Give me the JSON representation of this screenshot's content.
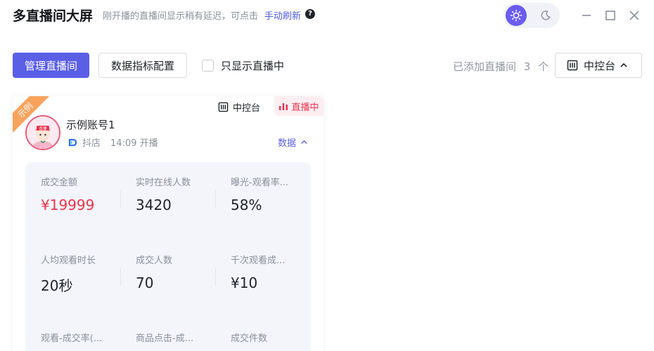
{
  "header": {
    "title": "多直播间大屏",
    "subtitle": "刚开播的直播间显示稍有延迟，可点击",
    "refresh_link": "手动刷新",
    "help_glyph": "?"
  },
  "theme": {
    "active": "light",
    "icons": [
      "sun-icon",
      "moon-icon"
    ],
    "accent": "#6b5cf0"
  },
  "window_controls": [
    "minimize-icon",
    "maximize-icon",
    "close-icon"
  ],
  "toolbar": {
    "manage_label": "管理直播间",
    "metrics_config_label": "数据指标配置",
    "only_live_label": "只显示直播中",
    "only_live_checked": false,
    "added_label": "已添加直播间",
    "added_count": "3",
    "added_unit": "个",
    "console_label": "中控台"
  },
  "card": {
    "ribbon_text": "示例",
    "console_label": "中控台",
    "live_label": "直播中",
    "account_name": "示例账号1",
    "avatar_text": "直播",
    "platform": "抖店",
    "start_time": "14:09 开播",
    "data_toggle_label": "数据",
    "metrics": [
      {
        "label": "成交金额",
        "value": "¥19999"
      },
      {
        "label": "实时在线人数",
        "value": "3420"
      },
      {
        "label": "曝光-观看率...",
        "value": "58%"
      },
      {
        "label": "人均观看时长",
        "value": "20秒"
      },
      {
        "label": "成交人数",
        "value": "70"
      },
      {
        "label": "千次观看成...",
        "value": "¥10"
      },
      {
        "label": "观看-成交率(...",
        "value": ""
      },
      {
        "label": "商品点击-成...",
        "value": ""
      },
      {
        "label": "成交件数",
        "value": ""
      }
    ]
  },
  "colors": {
    "primary": "#5b5fe6",
    "live_red": "#e8344e",
    "ribbon": "#f7a35c"
  }
}
